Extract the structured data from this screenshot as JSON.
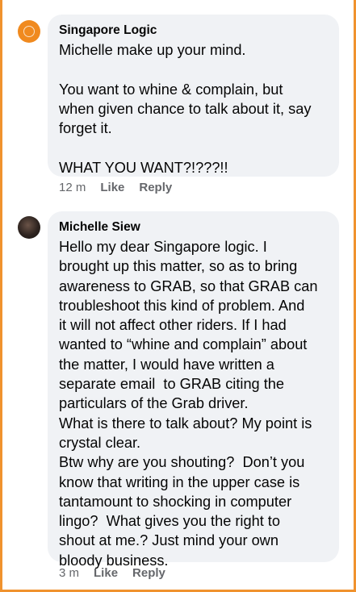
{
  "comments": [
    {
      "author": "Singapore Logic",
      "avatar_icon": "singapore-logic-avatar-icon",
      "avatar_color": "#f08a1f",
      "body": "Michelle make up your mind.\n\nYou want to whine & complain, but\nwhen given chance to talk about it, say\nforget it.\n\nWHAT YOU WANT?!???!!",
      "time": "12 m",
      "like_label": "Like",
      "reply_label": "Reply"
    },
    {
      "author": "Michelle Siew",
      "avatar_icon": "michelle-siew-avatar-icon",
      "body": "Hello my dear Singapore logic. I\nbrought up this matter, so as to bring\nawareness to GRAB, so that GRAB can\ntroubleshoot this kind of problem. And\nit will not affect other riders. If I had\nwanted to “whine and complain” about\nthe matter, I would have written a\nseparate email  to GRAB citing the\nparticulars of the Grab driver.\nWhat is there to talk about? My point is\ncrystal clear.\nBtw why are you shouting?  Don’t you\nknow that writing in the upper case is\ntantamount to shocking in computer\nlingo?  What gives you the right to\nshout at me.? Just mind your own\nbloody business.",
      "time": "3 m",
      "like_label": "Like",
      "reply_label": "Reply"
    }
  ],
  "colors": {
    "frame": "#f0922e",
    "bubble": "#f0f2f5",
    "meta_text": "#65676b"
  }
}
